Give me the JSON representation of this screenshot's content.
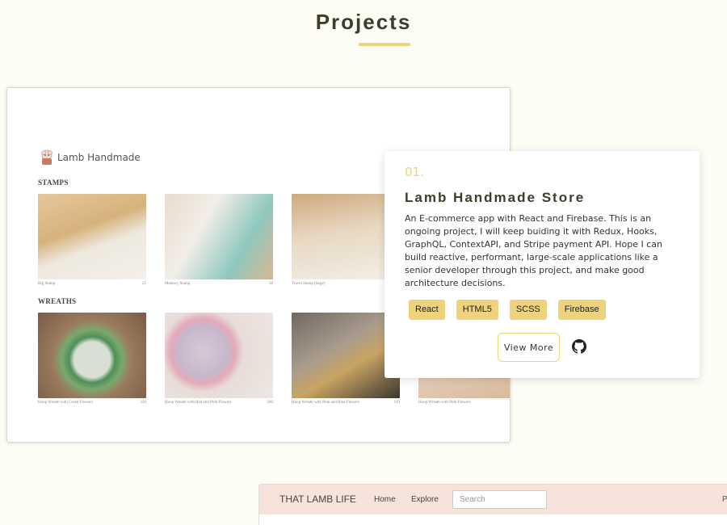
{
  "section": {
    "title": "Projects"
  },
  "screenshot": {
    "logo_text": "Lamb Handmade",
    "categories": [
      "STAMPS",
      "WREATHS"
    ],
    "products": [
      {
        "name": "Big Stamp",
        "price": "25"
      },
      {
        "name": "Memory Stamp",
        "price": "30"
      },
      {
        "name": "Travel Stamp (large)",
        "price": ""
      },
      {
        "name": "Hoop Wreath with Green Flowers",
        "price": "220"
      },
      {
        "name": "Hoop Wreath with Red and Pink Flowers",
        "price": "200"
      },
      {
        "name": "Hoop Wreath with Pink and Blue Flowers",
        "price": "110"
      },
      {
        "name": "Hoop Wreath with Pink Flowers",
        "price": ""
      }
    ]
  },
  "project": {
    "number": "01.",
    "title": "Lamb Handmade Store",
    "description": "An E-commerce app with React and Firebase. This is an ongoing project, I will keep buiding it with Redux, Hooks, GraphQL, ContextAPI, and Stripe payment API. Hope I can build reactive, performant, large-scale applications like a senior developer through this project, and make good architecture decisions.",
    "tags": [
      "React",
      "HTML5",
      "SCSS",
      "Firebase"
    ],
    "view_more_label": "View More",
    "github_icon": "github-icon"
  },
  "next_project": {
    "brand": "THAT LAMB LIFE",
    "nav": [
      "Home",
      "Explore"
    ],
    "search_placeholder": "Search",
    "truncated_text": "P"
  },
  "colors": {
    "accent": "#efd27c",
    "background": "#fdfcf5",
    "heading": "#3d3d2c",
    "navbar": "#f6e4dc"
  }
}
